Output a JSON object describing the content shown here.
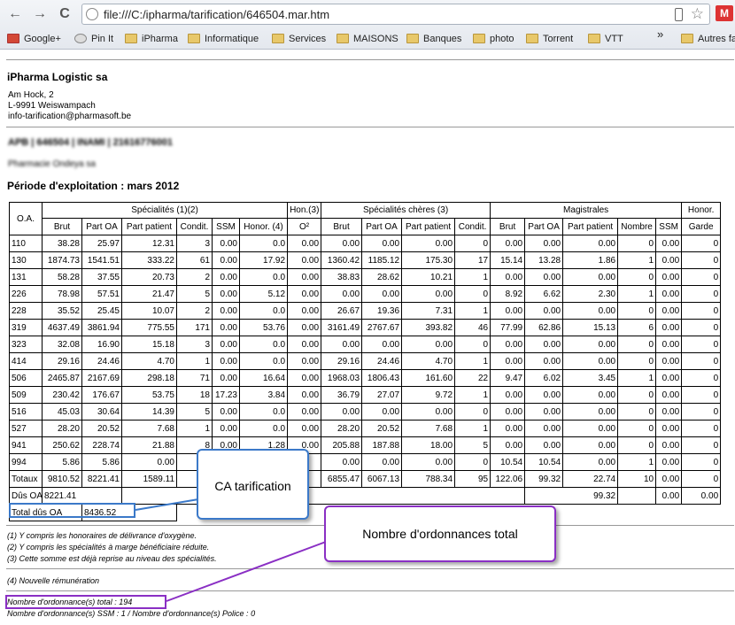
{
  "browser": {
    "url": "file:///C:/ipharma/tarification/646504.mar.htm",
    "back_glyph": "←",
    "forward_glyph": "→",
    "reload_glyph": "C",
    "star_glyph": "☆",
    "gmail_glyph": "M",
    "overflow_glyph": "»",
    "bookmarks": [
      "Google+",
      "Pin It",
      "iPharma",
      "Informatique",
      "Services",
      "MAISONS",
      "Banques",
      "photo",
      "Torrent",
      "VTT",
      "Autres fa"
    ]
  },
  "header": {
    "company": "iPharma Logistic sa",
    "address_lines": [
      "Am Hock, 2",
      "L-9991 Weiswampach",
      "info-tarification@pharmasoft.be"
    ],
    "blurred_id": "APB | 646504 | INAMI | 21616776001",
    "blurred_name": "Pharmacie Ondeya sa",
    "periode": "Période d'exploitation : mars 2012"
  },
  "table": {
    "group_headers": {
      "oa": "O.A.",
      "specialites": "Spécialités (1)(2)",
      "hon": "Hon.(3)",
      "specialites_cheres": "Spécialités chères (3)",
      "magistrales": "Magistrales",
      "honor": "Honor."
    },
    "sub_headers": [
      "Brut",
      "Part OA",
      "Part patient",
      "Condit.",
      "SSM",
      "Honor. (4)",
      "O²",
      "Brut",
      "Part OA",
      "Part patient",
      "Condit.",
      "Brut",
      "Part OA",
      "Part patient",
      "Nombre",
      "SSM",
      "Garde"
    ],
    "rows": [
      [
        "110",
        "38.28",
        "25.97",
        "12.31",
        "3",
        "0.00",
        "0.0",
        "0.00",
        "0.00",
        "0.00",
        "0.00",
        "0",
        "0.00",
        "0.00",
        "0.00",
        "0",
        "0.00",
        "0"
      ],
      [
        "130",
        "1874.73",
        "1541.51",
        "333.22",
        "61",
        "0.00",
        "17.92",
        "0.00",
        "1360.42",
        "1185.12",
        "175.30",
        "17",
        "15.14",
        "13.28",
        "1.86",
        "1",
        "0.00",
        "0"
      ],
      [
        "131",
        "58.28",
        "37.55",
        "20.73",
        "2",
        "0.00",
        "0.0",
        "0.00",
        "38.83",
        "28.62",
        "10.21",
        "1",
        "0.00",
        "0.00",
        "0.00",
        "0",
        "0.00",
        "0"
      ],
      [
        "226",
        "78.98",
        "57.51",
        "21.47",
        "5",
        "0.00",
        "5.12",
        "0.00",
        "0.00",
        "0.00",
        "0.00",
        "0",
        "8.92",
        "6.62",
        "2.30",
        "1",
        "0.00",
        "0"
      ],
      [
        "228",
        "35.52",
        "25.45",
        "10.07",
        "2",
        "0.00",
        "0.0",
        "0.00",
        "26.67",
        "19.36",
        "7.31",
        "1",
        "0.00",
        "0.00",
        "0.00",
        "0",
        "0.00",
        "0"
      ],
      [
        "319",
        "4637.49",
        "3861.94",
        "775.55",
        "171",
        "0.00",
        "53.76",
        "0.00",
        "3161.49",
        "2767.67",
        "393.82",
        "46",
        "77.99",
        "62.86",
        "15.13",
        "6",
        "0.00",
        "0"
      ],
      [
        "323",
        "32.08",
        "16.90",
        "15.18",
        "3",
        "0.00",
        "0.0",
        "0.00",
        "0.00",
        "0.00",
        "0.00",
        "0",
        "0.00",
        "0.00",
        "0.00",
        "0",
        "0.00",
        "0"
      ],
      [
        "414",
        "29.16",
        "24.46",
        "4.70",
        "1",
        "0.00",
        "0.0",
        "0.00",
        "29.16",
        "24.46",
        "4.70",
        "1",
        "0.00",
        "0.00",
        "0.00",
        "0",
        "0.00",
        "0"
      ],
      [
        "506",
        "2465.87",
        "2167.69",
        "298.18",
        "71",
        "0.00",
        "16.64",
        "0.00",
        "1968.03",
        "1806.43",
        "161.60",
        "22",
        "9.47",
        "6.02",
        "3.45",
        "1",
        "0.00",
        "0"
      ],
      [
        "509",
        "230.42",
        "176.67",
        "53.75",
        "18",
        "17.23",
        "3.84",
        "0.00",
        "36.79",
        "27.07",
        "9.72",
        "1",
        "0.00",
        "0.00",
        "0.00",
        "0",
        "0.00",
        "0"
      ],
      [
        "516",
        "45.03",
        "30.64",
        "14.39",
        "5",
        "0.00",
        "0.0",
        "0.00",
        "0.00",
        "0.00",
        "0.00",
        "0",
        "0.00",
        "0.00",
        "0.00",
        "0",
        "0.00",
        "0"
      ],
      [
        "527",
        "28.20",
        "20.52",
        "7.68",
        "1",
        "0.00",
        "0.0",
        "0.00",
        "28.20",
        "20.52",
        "7.68",
        "1",
        "0.00",
        "0.00",
        "0.00",
        "0",
        "0.00",
        "0"
      ],
      [
        "941",
        "250.62",
        "228.74",
        "21.88",
        "8",
        "0.00",
        "1.28",
        "0.00",
        "205.88",
        "187.88",
        "18.00",
        "5",
        "0.00",
        "0.00",
        "0.00",
        "0",
        "0.00",
        "0"
      ],
      [
        "994",
        "5.86",
        "5.86",
        "0.00",
        "",
        "",
        "",
        "",
        "0.00",
        "0.00",
        "0.00",
        "0",
        "10.54",
        "10.54",
        "0.00",
        "1",
        "0.00",
        "0"
      ]
    ],
    "totals": {
      "label": "Totaux",
      "brut": "9810.52",
      "part_oa": "8221.41",
      "part_patient": "1589.11",
      "condit": "3",
      "sc_brut": "6855.47",
      "sc_part_oa": "6067.13",
      "sc_part_patient": "788.34",
      "sc_condit": "95",
      "m_brut": "122.06",
      "m_part_oa": "99.32",
      "m_part_patient": "22.74",
      "m_nombre": "10",
      "m_ssm": "0.00",
      "garde": "0"
    },
    "dus": {
      "label": "Dûs OA",
      "value": "8221.41",
      "magistrales": "99.32",
      "ssm": "0.00",
      "garde": "0.00"
    },
    "total_dus": {
      "label": "Total dûs OA",
      "value": "8436.52"
    }
  },
  "notes": [
    "(1) Y compris les honoraires de délivrance d'oxygène.",
    "(2) Y compris les spécialités à marge bénéficiaire réduite.",
    "(3) Cette somme est déjà reprise au niveau des spécialités.",
    "(4) Nouvelle rémunération"
  ],
  "footer": {
    "nb_ordonnances": "Nombre d'ordonnance(s) total : 194",
    "nb_ssm_police": "Nombre d'ordonnance(s) SSM : 1 / Nombre d'ordonnance(s) Police : 0"
  },
  "callouts": {
    "ca": "CA tarification",
    "nb": "Nombre d'ordonnances total"
  },
  "colors": {
    "callout_blue": "#3b79c9",
    "callout_purple": "#8a2fc4"
  }
}
